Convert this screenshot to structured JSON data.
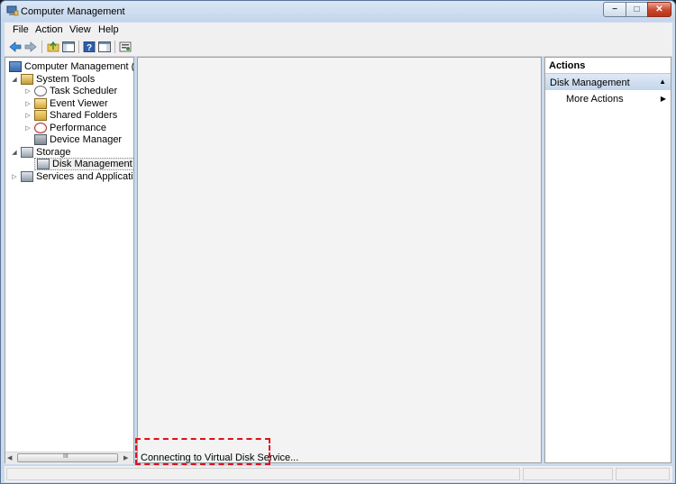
{
  "window": {
    "title": "Computer Management",
    "caption_buttons": {
      "minimize": "−",
      "maximize": "□",
      "close": "✕"
    }
  },
  "menu": [
    "File",
    "Action",
    "View",
    "Help"
  ],
  "toolbar": {
    "icons": [
      "back-arrow-icon",
      "forward-arrow-icon",
      "up-folder-icon",
      "show-hide-console-tree-icon",
      "help-icon",
      "show-hide-action-pane-icon",
      "properties-icon"
    ]
  },
  "tree": {
    "root": "Computer Management (Local",
    "items": [
      {
        "label": "System Tools",
        "arrow": "◢"
      },
      {
        "label": "Task Scheduler",
        "arrow": "▷"
      },
      {
        "label": "Event Viewer",
        "arrow": "▷"
      },
      {
        "label": "Shared Folders",
        "arrow": "▷"
      },
      {
        "label": "Performance",
        "arrow": "▷"
      },
      {
        "label": "Device Manager",
        "arrow": ""
      },
      {
        "label": "Storage",
        "arrow": "◢"
      },
      {
        "label": "Disk Management",
        "arrow": ""
      },
      {
        "label": "Services and Applications",
        "arrow": "▷"
      }
    ],
    "scroll_grip": "III"
  },
  "status": {
    "message": "Connecting to Virtual Disk Service..."
  },
  "actions": {
    "title": "Actions",
    "section": "Disk Management",
    "more": "More Actions"
  },
  "colors": {
    "highlight_dash": "#e0101a",
    "title_gradient_top": "#dbe7f5",
    "actions_section": "#c3d5ea"
  }
}
